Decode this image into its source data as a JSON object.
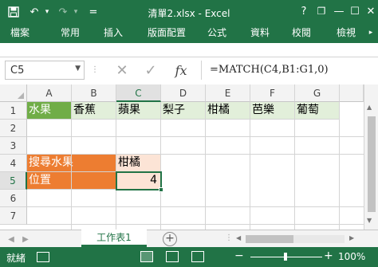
{
  "window": {
    "title": "清單2.xlsx - Excel",
    "help": "?",
    "restore_symbol": "❐",
    "minimize_symbol": "—",
    "maximize_symbol": "☐",
    "close_symbol": "✕"
  },
  "quick_access": {
    "save_icon": "💾",
    "undo_icon": "↶",
    "undo_dropdown": "▾",
    "redo_icon": "↷",
    "redo_dropdown": "▾",
    "customize": "="
  },
  "ribbon": {
    "tabs": [
      "檔案",
      "常用",
      "插入",
      "版面配置",
      "公式",
      "資料",
      "校閱",
      "檢視"
    ]
  },
  "formula_bar": {
    "name_box": "C5",
    "cancel": "✕",
    "enter": "✓",
    "fx": "fx",
    "formula": "=MATCH(C4,B1:G1,0)"
  },
  "sheet": {
    "columns": [
      "A",
      "B",
      "C",
      "D",
      "E",
      "F",
      "G"
    ],
    "rows": [
      "1",
      "2",
      "3",
      "4",
      "5",
      "6",
      "7"
    ],
    "fruits_header": [
      "水果",
      "香蕉",
      "蘋果",
      "梨子",
      "柑橘",
      "芭樂",
      "葡萄"
    ],
    "search_label": "搜尋水果",
    "search_value": "柑橘",
    "position_label": "位置",
    "position_value": "4"
  },
  "sheet_tabs": {
    "active": "工作表1",
    "add": "+",
    "prev": "◀",
    "next": "▶"
  },
  "status": {
    "ready": "就緒",
    "zoom": "100%",
    "zoom_out": "−",
    "zoom_in": "+"
  },
  "colors": {
    "accent": "#217346",
    "header_green": "#e2efda",
    "header_green_dark": "#70ad47",
    "label_orange": "#ed7d31",
    "value_peach": "#fce4d6"
  }
}
